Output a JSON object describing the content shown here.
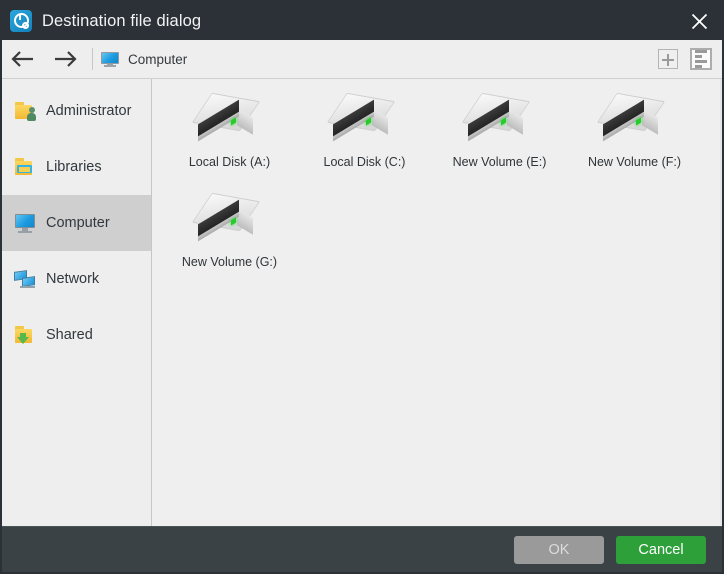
{
  "window": {
    "title": "Destination file dialog",
    "app_icon": "clock-gear-icon",
    "close_icon": "close-icon"
  },
  "toolbar": {
    "back_icon": "arrow-left-icon",
    "forward_icon": "arrow-right-icon",
    "breadcrumb": {
      "icon": "computer-monitor-icon",
      "label": "Computer"
    },
    "new_folder_icon": "plus-square-icon",
    "view_list_icon": "list-view-icon"
  },
  "sidebar": {
    "items": [
      {
        "label": "Administrator",
        "icon": "user-folder-icon",
        "active": false
      },
      {
        "label": "Libraries",
        "icon": "libraries-folder-icon",
        "active": false
      },
      {
        "label": "Computer",
        "icon": "computer-monitor-icon",
        "active": true
      },
      {
        "label": "Network",
        "icon": "network-icon",
        "active": false
      },
      {
        "label": "Shared",
        "icon": "shared-folder-icon",
        "active": false
      }
    ]
  },
  "content": {
    "items": [
      {
        "label": "Local Disk (A:)",
        "icon": "hard-drive-icon"
      },
      {
        "label": "Local Disk (C:)",
        "icon": "hard-drive-icon"
      },
      {
        "label": "New Volume (E:)",
        "icon": "hard-drive-icon"
      },
      {
        "label": "New Volume (F:)",
        "icon": "hard-drive-icon"
      },
      {
        "label": "New Volume (G:)",
        "icon": "hard-drive-icon"
      }
    ]
  },
  "footer": {
    "ok_label": "OK",
    "cancel_label": "Cancel"
  },
  "colors": {
    "titlebar": "#2b3136",
    "footer": "#3a4246",
    "accent_green": "#2ea03a",
    "ok_disabled": "#9a9a9a",
    "sidebar_selected": "#cfcfcf",
    "content_bg": "#efefef",
    "drive_led": "#25cc2a"
  }
}
